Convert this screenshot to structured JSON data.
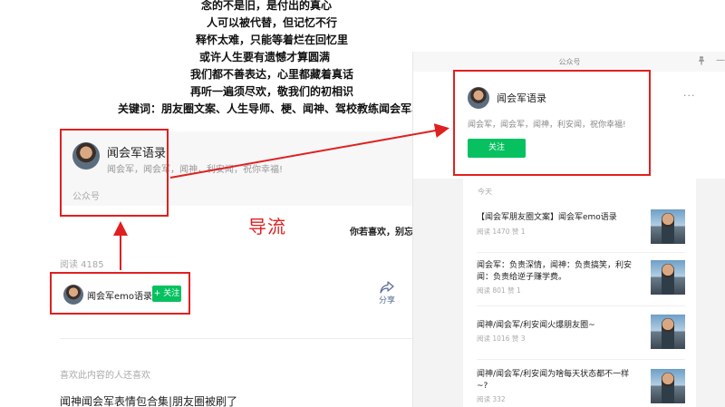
{
  "article": {
    "lines": [
      "念的不是旧，是付出的真心",
      "人可以被代替，但记忆不行",
      "释怀太难，只能等着烂在回忆里",
      "或许人生要有遗憾才算圆满",
      "我们都不善表达，心里都藏着真话",
      "再听一遍须尽欢，敬我们的初相识",
      "关键词：朋友圈文案、人生导师、梗、闻神、驾校教练闻会军、e"
    ],
    "account_card": {
      "name": "闻会军语录",
      "desc": "闻会军，闻会军，闻神，利安闻，祝你幸福!",
      "tag": "公众号"
    },
    "annotation": "导流",
    "like_text": "你若喜欢，别忘",
    "read_count": "阅读 4185",
    "author": {
      "name": "闻会军emo语录",
      "follow_label": "+ 关注"
    },
    "share_label": "分享",
    "also_liked": "喜欢此内容的人还喜欢",
    "related_title": "闻神闻会军表情包合集|朋友圈被刷了"
  },
  "panel": {
    "title": "公众号",
    "pin_icon": "pin-icon",
    "minimize_icon": "minimize-icon",
    "profile": {
      "name": "闻会军语录",
      "more": "···",
      "desc": "闻会军，闻会军，闻神，利安闻，祝你幸福!",
      "follow_label": "关注"
    },
    "feed": {
      "today": "今天",
      "items": [
        {
          "title": "【闻会军朋友圈文案】闻会军emo语录",
          "meta": "阅读 1470  赞 1"
        },
        {
          "title": "闻会军：负责深情，闻神：负责搞笑，利安闻：负责给逆子赚学费。",
          "meta": "阅读 801  赞 1"
        },
        {
          "title": "闻神/闻会军/利安闻火爆朋友圈~",
          "meta": "阅读 1016  赞 3"
        },
        {
          "title": "闻神/闻会军/利安闻为啥每天状态都不一样~?",
          "meta": "阅读 332"
        }
      ]
    }
  },
  "colors": {
    "accent_green": "#07c160",
    "annotation_red": "#e02020",
    "link_blue": "#576b95"
  }
}
